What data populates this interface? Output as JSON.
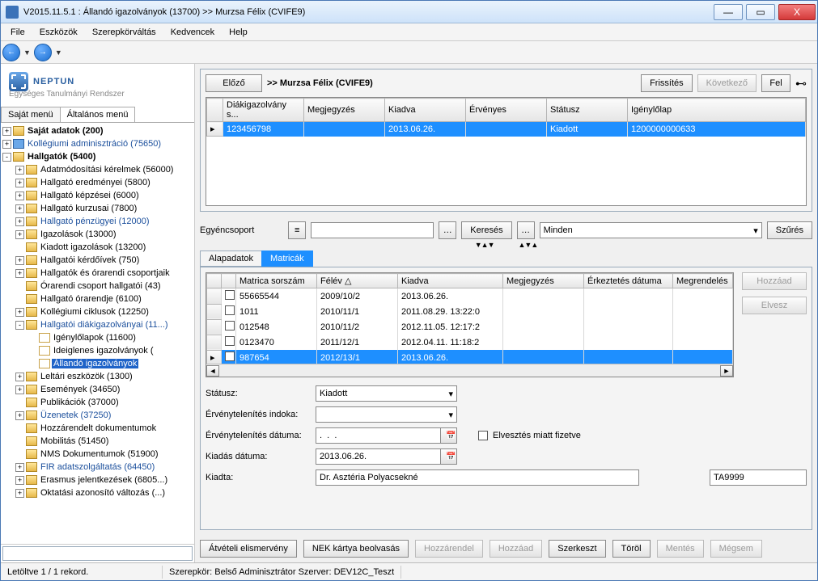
{
  "window": {
    "title": "V2015.11.5.1 : Állandó igazolványok (13700)  >> Murzsa Félix (CVIFE9)"
  },
  "win_btns": {
    "min": "—",
    "max": "▭",
    "close": "X"
  },
  "menubar": [
    "File",
    "Eszközök",
    "Szerepkörváltás",
    "Kedvencek",
    "Help"
  ],
  "logo": {
    "brand": "NEPTUN",
    "sub": "Egységes Tanulmányi Rendszer"
  },
  "sidetabs": {
    "a": "Saját menü",
    "b": "Általános menü"
  },
  "tree": [
    {
      "ind": 0,
      "pm": "+",
      "ico": "folder",
      "label": "Saját adatok  (200)",
      "cls": "bold"
    },
    {
      "ind": 0,
      "pm": "+",
      "ico": "blue",
      "label": "Kollégiumi adminisztráció (75650)",
      "cls": "link"
    },
    {
      "ind": 0,
      "pm": "-",
      "ico": "folder",
      "label": "Hallgatók (5400)",
      "cls": "bold"
    },
    {
      "ind": 1,
      "pm": "+",
      "ico": "folder",
      "label": "Adatmódosítási kérelmek (56000)"
    },
    {
      "ind": 1,
      "pm": "+",
      "ico": "folder",
      "label": "Hallgató eredményei (5800)"
    },
    {
      "ind": 1,
      "pm": "+",
      "ico": "folder",
      "label": "Hallgató képzései (6000)"
    },
    {
      "ind": 1,
      "pm": "+",
      "ico": "folder",
      "label": "Hallgató kurzusai (7800)"
    },
    {
      "ind": 1,
      "pm": "+",
      "ico": "folder",
      "label": "Hallgató pénzügyei (12000)",
      "cls": "link"
    },
    {
      "ind": 1,
      "pm": "+",
      "ico": "folder",
      "label": "Igazolások (13000)"
    },
    {
      "ind": 1,
      "pm": "",
      "ico": "folder",
      "label": "Kiadott igazolások (13200)"
    },
    {
      "ind": 1,
      "pm": "+",
      "ico": "folder",
      "label": "Hallgatói kérdőívek (750)"
    },
    {
      "ind": 1,
      "pm": "+",
      "ico": "folder",
      "label": "Hallgatók és órarendi csoportjaik"
    },
    {
      "ind": 1,
      "pm": "",
      "ico": "folder",
      "label": "Órarendi csoport hallgatói (43)"
    },
    {
      "ind": 1,
      "pm": "",
      "ico": "folder",
      "label": "Hallgató órarendje (6100)"
    },
    {
      "ind": 1,
      "pm": "+",
      "ico": "folder",
      "label": "Kollégiumi ciklusok (12250)"
    },
    {
      "ind": 1,
      "pm": "-",
      "ico": "folder",
      "label": "Hallgatói diákigazolványai (11...)",
      "cls": "link"
    },
    {
      "ind": 2,
      "pm": "",
      "ico": "page",
      "label": "Igénylőlapok (11600)"
    },
    {
      "ind": 2,
      "pm": "",
      "ico": "page",
      "label": "Ideiglenes igazolványok ("
    },
    {
      "ind": 2,
      "pm": "",
      "ico": "page",
      "label": "Állandó igazolványok",
      "cls": "sel"
    },
    {
      "ind": 1,
      "pm": "+",
      "ico": "folder",
      "label": "Leltári eszközök (1300)"
    },
    {
      "ind": 1,
      "pm": "+",
      "ico": "folder",
      "label": "Események (34650)"
    },
    {
      "ind": 1,
      "pm": "",
      "ico": "folder",
      "label": "Publikációk (37000)"
    },
    {
      "ind": 1,
      "pm": "+",
      "ico": "folder",
      "label": "Üzenetek (37250)",
      "cls": "link"
    },
    {
      "ind": 1,
      "pm": "",
      "ico": "folder",
      "label": "Hozzárendelt dokumentumok"
    },
    {
      "ind": 1,
      "pm": "",
      "ico": "folder",
      "label": "Mobilitás (51450)"
    },
    {
      "ind": 1,
      "pm": "",
      "ico": "folder",
      "label": "NMS Dokumentumok (51900)"
    },
    {
      "ind": 1,
      "pm": "+",
      "ico": "folder",
      "label": "FIR adatszolgáltatás (64450)",
      "cls": "link"
    },
    {
      "ind": 1,
      "pm": "+",
      "ico": "folder",
      "label": "Erasmus jelentkezések (6805...)"
    },
    {
      "ind": 1,
      "pm": "+",
      "ico": "folder",
      "label": "Oktatási azonosító változás (...)"
    }
  ],
  "header": {
    "prev": "Előző",
    "title": ">> Murzsa Félix (CVIFE9)",
    "refresh": "Frissítés",
    "next": "Következő",
    "up": "Fel"
  },
  "grid1": {
    "cols": [
      "",
      "Diákigazolvány s...",
      "Megjegyzés",
      "Kiadva",
      "Érvényes",
      "Státusz",
      "Igénylőlap"
    ],
    "row": [
      "",
      "123456798",
      "",
      "2013.06.26.",
      "",
      "Kiadott",
      "1200000000633"
    ]
  },
  "search": {
    "label": "Egyéncsoport",
    "btn": "Keresés",
    "all": "Minden",
    "filter": "Szűrés"
  },
  "tabs2": {
    "a": "Alapadatok",
    "b": "Matricák"
  },
  "grid2": {
    "cols": [
      "",
      "",
      "Matrica sorszám",
      "Félév",
      "Kiadva",
      "Megjegyzés",
      "Érkeztetés dátuma",
      "Megrendelés"
    ],
    "rows": [
      [
        "",
        "",
        "55665544",
        "2009/10/2",
        "2013.06.26.",
        "",
        "",
        ""
      ],
      [
        "",
        "",
        "1011",
        "2010/11/1",
        "2011.08.29. 13:22:0",
        "",
        "",
        ""
      ],
      [
        "",
        "",
        "012548",
        "2010/11/2",
        "2012.11.05. 12:17:2",
        "",
        "",
        ""
      ],
      [
        "",
        "",
        "0123470",
        "2011/12/1",
        "2012.04.11. 11:18:2",
        "",
        "",
        ""
      ],
      [
        "",
        "",
        "987654",
        "2012/13/1",
        "2013.06.26.",
        "",
        "",
        ""
      ]
    ],
    "sortcol": "Félév",
    "sortdir": "△"
  },
  "sidebtns": {
    "add": "Hozzáad",
    "remove": "Elvesz"
  },
  "form": {
    "status_lbl": "Státusz:",
    "status_val": "Kiadott",
    "inval_reason_lbl": "Érvénytelenítés indoka:",
    "inval_date_lbl": "Érvénytelenítés dátuma:",
    "inval_date_val": ".  .  .",
    "loss_chk": "Elvesztés miatt fizetve",
    "issue_date_lbl": "Kiadás dátuma:",
    "issue_date_val": "2013.06.26.",
    "issuer_lbl": "Kiadta:",
    "issuer_name": "Dr. Asztéria Polyacsekné",
    "issuer_code": "TA9999"
  },
  "buttons": {
    "receipt": "Átvételi elismervény",
    "nek": "NEK kártya beolvasás",
    "assign": "Hozzárendel",
    "add": "Hozzáad",
    "edit": "Szerkeszt",
    "delete": "Töröl",
    "save": "Mentés",
    "cancel": "Mégsem"
  },
  "status": {
    "records": "Letöltve 1 / 1 rekord.",
    "role": "Szerepkör: Belső Adminisztrátor   Szerver: DEV12C_Teszt"
  }
}
